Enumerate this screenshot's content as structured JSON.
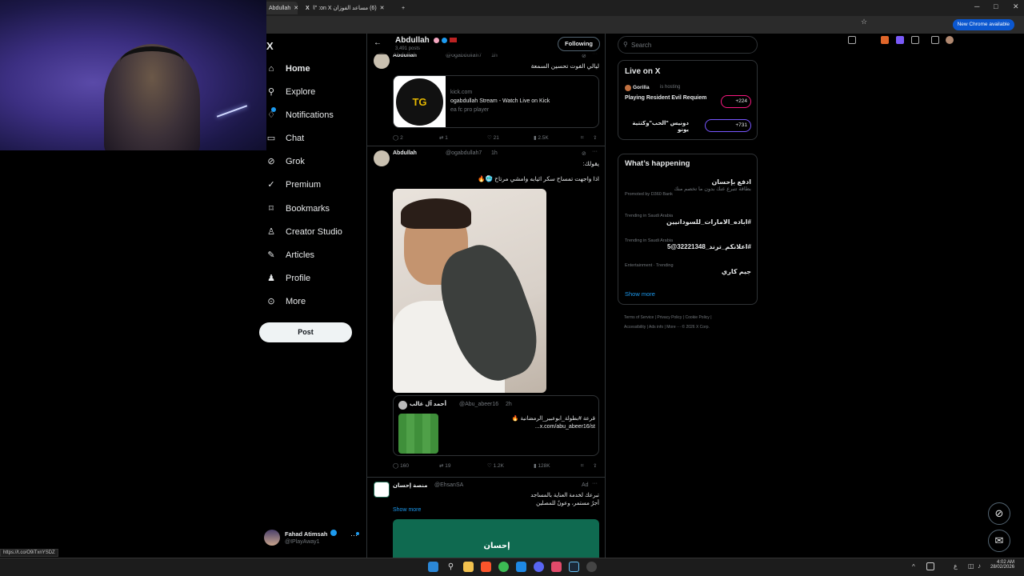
{
  "browser": {
    "tabs": [
      {
        "label": "Abdullah"
      },
      {
        "label": "(6) مساعد الفوزان on X: \"الحلقة"
      }
    ],
    "new_chrome": "New Chrome available",
    "status_url": "https://t.co/O9iTxnYSDZ"
  },
  "nav": {
    "logo": "X",
    "items": [
      {
        "label": "Home",
        "icon": "home-icon"
      },
      {
        "label": "Explore",
        "icon": "search-icon"
      },
      {
        "label": "Notifications",
        "icon": "bell-icon"
      },
      {
        "label": "Chat",
        "icon": "chat-icon"
      },
      {
        "label": "Grok",
        "icon": "grok-icon"
      },
      {
        "label": "Premium",
        "icon": "premium-icon"
      },
      {
        "label": "Bookmarks",
        "icon": "bookmark-icon"
      },
      {
        "label": "Creator Studio",
        "icon": "creator-icon"
      },
      {
        "label": "Articles",
        "icon": "articles-icon"
      },
      {
        "label": "Profile",
        "icon": "profile-icon"
      },
      {
        "label": "More",
        "icon": "more-icon"
      }
    ],
    "post_label": "Post",
    "account": {
      "name": "Fahad Atimsah",
      "handle": "@IPlayAway1"
    }
  },
  "profile_header": {
    "name": "Abdullah",
    "posts_count": "3,491 posts",
    "follow_label": "Following"
  },
  "tweets": [
    {
      "author": "Abdullah",
      "handle": "@ogabdullah7",
      "time": "1h",
      "text": "ليالي الفوت تحسين السمعة",
      "link_card": {
        "domain": "kick.com",
        "title": "ogabdullah Stream - Watch Live on Kick",
        "subtitle": "ea fc pro player",
        "thumb_text": "TG"
      },
      "stats": {
        "replies": "2",
        "reposts": "1",
        "likes": "21",
        "views": "2.5K"
      }
    },
    {
      "author": "Abdullah",
      "handle": "@ogabdullah7",
      "time": "1h",
      "line1": "يقولك:",
      "line2": "اذا واجهت تمساح سكر اثيابه وامشي مرتاح 🥶🔥",
      "quote": {
        "author": "أحمد آل غالب",
        "handle": "@Abu_abeer16",
        "time": "2h",
        "line1": "قرعة #بطولة_ابوعبير_الرمضانية 🔥",
        "line2": "x.com/abu_abeer16/st..."
      },
      "stats": {
        "replies": "160",
        "reposts": "19",
        "likes": "1.2K",
        "views": "128K"
      }
    },
    {
      "author": "منصة إحسان",
      "handle": "@EhsanSA",
      "ad": "Ad",
      "line1": "تبرعك لخدمة العناية بالمساجد",
      "line2": "أجرٌ مستمر، وعونٌ للمصلين",
      "show_more": "Show more",
      "banner_text": "إحسان"
    }
  ],
  "right": {
    "search_placeholder": "Search",
    "live": {
      "title": "Live on X",
      "items": [
        {
          "host": "Gorilla",
          "host_suffix": "is hosting",
          "title": "Playing Resident Evil Requiem",
          "count": "+224"
        },
        {
          "title": "دونيس \"الحب\"وكتتية يونو",
          "count": "+731"
        }
      ]
    },
    "happening": {
      "title": "What’s happening",
      "items": [
        {
          "title": "ادفع بإحسان",
          "desc": "بطاقة تتبرع عنك بدون ما تخصم منك",
          "meta": "Promoted by D360 Bank"
        },
        {
          "meta": "Trending in Saudi Arabia",
          "title": "#اباده_الامارات_للسودانيين"
        },
        {
          "meta": "Trending in Saudi Arabia",
          "title": "#اعلانكم_ترند_32221348@5"
        },
        {
          "meta": "Entertainment · Trending",
          "title": "جيم كاري"
        }
      ],
      "show_more": "Show more"
    },
    "footer": [
      "Terms of Service",
      "Privacy Policy",
      "Cookie Policy",
      "Accessibility",
      "Ads info",
      "More ···",
      "© 2026 X Corp."
    ]
  },
  "taskbar": {
    "time": "4:02 AM",
    "date": "28/02/2026"
  }
}
